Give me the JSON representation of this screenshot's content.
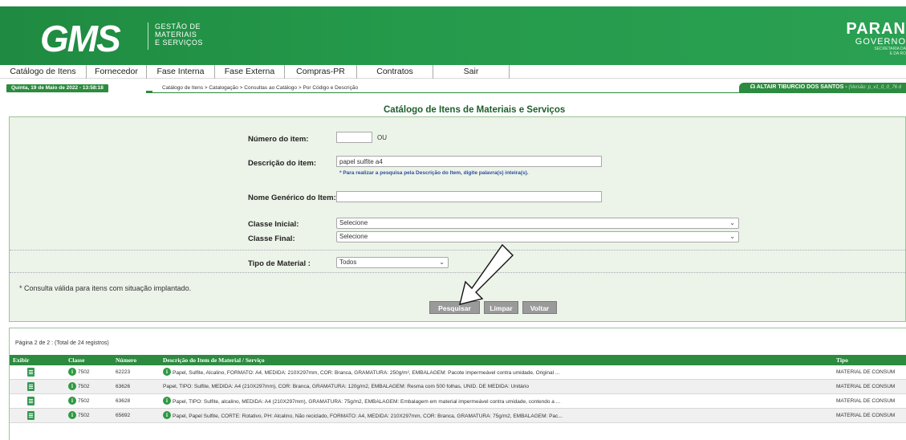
{
  "header": {
    "logo_text": "GMS",
    "logo_lines": [
      "GESTÃO DE",
      "MATERIAIS",
      "E SERVIÇOS"
    ],
    "gov_state": "PARAN",
    "gov_sub": "GOVERNO",
    "gov_tiny1": "SECRETARIA DA",
    "gov_tiny2": "E DA RO"
  },
  "menu": {
    "items": [
      "Catálogo de Itens",
      "Fornecedor",
      "Fase Interna",
      "Fase Externa",
      "Compras-PR",
      "Contratos",
      "Sair"
    ]
  },
  "status": {
    "date": "Quinta, 19 de Maio de 2022 - 13:58:18",
    "breadcrumb": "Catálogo de Itens > Catalogação > Consultas ao Catálogo > Por Código e Descrição",
    "user": "ALTAIR TIBURCIO DOS SANTOS - ",
    "version": "(Versão: p_v1_0_0_76 d"
  },
  "page": {
    "title": "Catálogo de Itens de Materiais e Serviços"
  },
  "form": {
    "numero_label": "Número do item:",
    "numero_value": "",
    "ou": "OU",
    "descricao_label": "Descrição do item:",
    "descricao_value": "papel sulfite a4",
    "descricao_hint": "* Para realizar a pesquisa pela Descrição do Item, digite palavra(s) inteira(s).",
    "nome_label": "Nome Genérico do Item:",
    "nome_value": "",
    "classe_inicial_label": "Classe Inicial:",
    "classe_inicial_value": "Selecione",
    "classe_final_label": "Classe Final:",
    "classe_final_value": "Selecione",
    "tipo_label": "Tipo de Material :",
    "tipo_value": "Todos",
    "note": "* Consulta válida para itens com situação implantado.",
    "btn_pesquisar": "Pesquisar",
    "btn_limpar": "Limpar",
    "btn_voltar": "Voltar"
  },
  "results": {
    "pager": "Página 2 de 2 : (Total de 24 registros)",
    "columns": [
      "Exibir",
      "Classe",
      "Número",
      "Descrição do Item de Material / Serviço",
      "Tipo"
    ],
    "rows": [
      {
        "classe": "7502",
        "numero": "62223",
        "descricao": "Papel, Sulfite, Alcalino, FORMATO: A4, MEDIDA: 210X297mm, COR: Branca, GRAMATURA: 250g/m², EMBALAGEM: Pacote impermeável contra umidade, Original ...",
        "tipo": "MATERIAL DE CONSUM",
        "has_info": true
      },
      {
        "classe": "7502",
        "numero": "63626",
        "descricao": "Papel, TIPO: Sulfite, MEDIDA: A4 (210X297mm), COR: Branca, GRAMATURA: 120g/m2, EMBALAGEM: Resma com 500 folhas, UNID. DE MEDIDA: Unitário",
        "tipo": "MATERIAL DE CONSUM",
        "has_info": false
      },
      {
        "classe": "7502",
        "numero": "63628",
        "descricao": "Papel, TIPO: Sulfite, alcalino, MEDIDA: A4 (210X297mm), GRAMATURA: 75g/m2, EMBALAGEM: Embalagem em material impermeável contra umidade, contendo a ...",
        "tipo": "MATERIAL DE CONSUM",
        "has_info": true
      },
      {
        "classe": "7502",
        "numero": "65692",
        "descricao": "Papel, Papel Sulfite, CORTE: Rotativo, PH: Alcalino, Não reciclado, FORMATO: A4, MEDIDA: 210X297mm, COR: Branca, GRAMATURA: 75g/m2, EMBALAGEM: Pac...",
        "tipo": "MATERIAL DE CONSUM",
        "has_info": true
      }
    ]
  },
  "colors": {
    "brand_green": "#2c8b3f",
    "panel_bg": "#ecf3e8",
    "button_gray": "#9a9a9a"
  }
}
